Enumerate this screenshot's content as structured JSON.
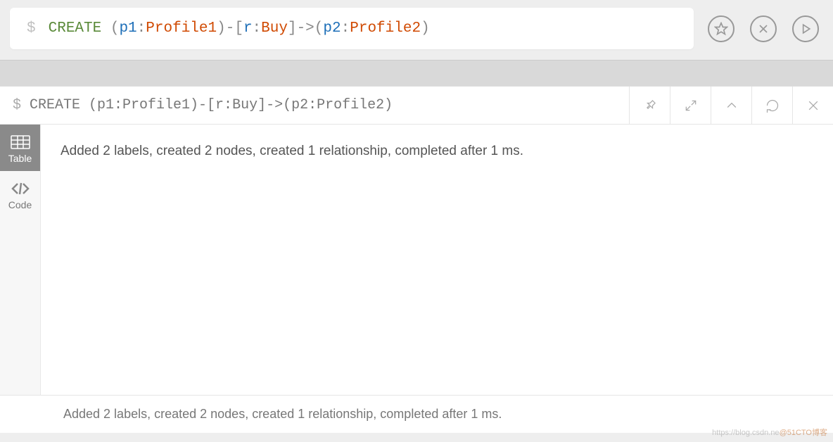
{
  "query_input": {
    "prompt": "$",
    "tokens": {
      "create": "CREATE",
      "p1": "p1",
      "colon": ":",
      "profile1": "Profile1",
      "r": "r",
      "buy": "Buy",
      "p2": "p2",
      "profile2": "Profile2",
      "open_paren": "(",
      "close_paren": ")",
      "open_bracket": "[",
      "close_bracket": "]",
      "dash": "-",
      "arrow": "->"
    }
  },
  "result": {
    "header_query": "CREATE (p1:Profile1)-[r:Buy]->(p2:Profile2)",
    "header_prompt": "$",
    "message": "Added 2 labels, created 2 nodes, created 1 relationship, completed after 1 ms.",
    "footer_message": "Added 2 labels, created 2 nodes, created 1 relationship, completed after 1 ms."
  },
  "view_tabs": {
    "table": "Table",
    "code": "Code"
  },
  "watermark": {
    "left": "https://blog.csdn.ne",
    "right": "@51CTO博客"
  }
}
